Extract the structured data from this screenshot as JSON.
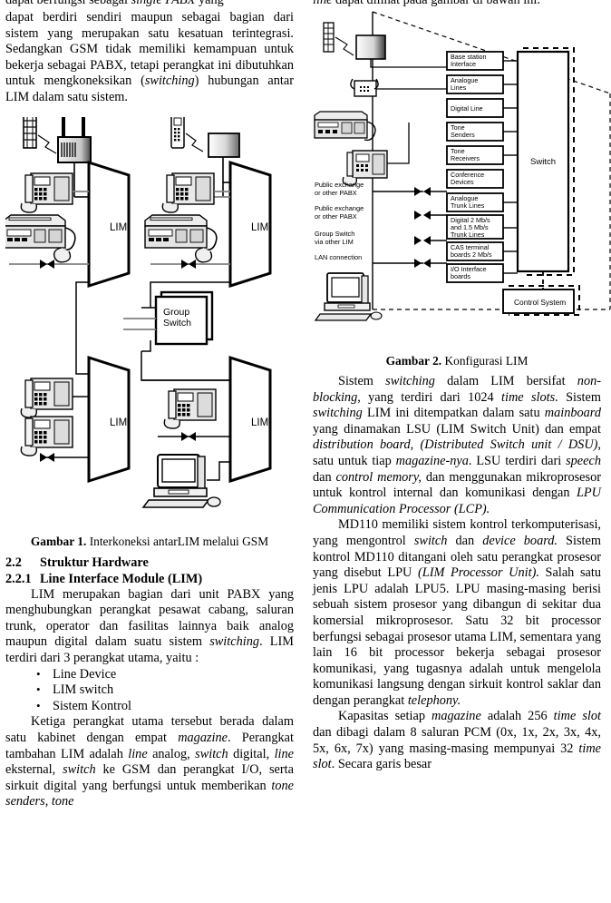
{
  "document": {
    "language": "id",
    "page_layout": "two-column"
  },
  "left_column": {
    "paragraph_top_clipped": "dapat berfungsi sebagai single PABX yang",
    "paragraph_1": "dapat berdiri sendiri maupun sebagai bagian dari sistem yang merupakan satu kesatuan terintegrasi. Sedangkan GSM tidak memiliki kemampuan untuk bekerja sebagai PABX, tetapi perangkat ini dibutuhkan untuk mengkoneksikan (switching) hubungan antar LIM dalam satu sistem.",
    "figure1": {
      "caption_label": "Gambar 1.",
      "caption_text": "Interkoneksi antarLIM melalui GSM",
      "lim_label": "LIM",
      "group_switch_label_line1": "Group",
      "group_switch_label_line2": "Switch",
      "lim_blocks": [
        "LIM",
        "LIM",
        "LIM",
        "LIM"
      ]
    },
    "section_2_2": {
      "number": "2.2",
      "title": "Struktur Hardware"
    },
    "section_2_2_1": {
      "number": "2.2.1",
      "title": "Line Interface Module (LIM)"
    },
    "paragraph_2": "LIM merupakan bagian dari unit PABX yang menghubungkan perangkat pesawat cabang, saluran trunk, operator dan fasilitas lainnya baik analog maupun digital dalam suatu sistem switching. LIM terdiri dari 3 perangkat utama, yaitu :",
    "bullets": [
      "Line Device",
      "LIM switch",
      "Sistem Kontrol"
    ],
    "paragraph_3": "Ketiga perangkat utama tersebut berada dalam satu kabinet dengan empat magazine. Perangkat tambahan LIM adalah line analog, switch digital, line eksternal, switch ke GSM dan perangkat I/O, serta sirkuit digital yang berfungsi untuk memberikan tone senders, tone"
  },
  "right_column": {
    "paragraph_top_clipped": "line dapat dilihat pada gambar di bawah ini.",
    "figure2": {
      "caption_label": "Gambar 2.",
      "caption_text": "Konfigurasi LIM",
      "switch_label": "Switch",
      "control_system_label": "Control System",
      "device_boxes": [
        {
          "line1": "Base station",
          "line2": "Interface"
        },
        {
          "line1": "Analogue",
          "line2": "Lines"
        },
        {
          "line1": "Digital Line",
          "line2": ""
        },
        {
          "line1": "Tone",
          "line2": "Senders"
        },
        {
          "line1": "Tone",
          "line2": "Receivers"
        },
        {
          "line1": "Conference",
          "line2": "Devices"
        },
        {
          "line1": "Analogue",
          "line2": "Trunk Lines"
        },
        {
          "line1": "Digital 2 Mb/s",
          "line2": "and 1.5 Mb/s",
          "line3": "Trunk Lines"
        },
        {
          "line1": "CAS terminal",
          "line2": "boards 2 Mb/s"
        },
        {
          "line1": "I/O Interface",
          "line2": "boards"
        }
      ],
      "left_labels": [
        {
          "line1": "Public exchange",
          "line2": "or other PABX"
        },
        {
          "line1": "Public exchange",
          "line2": "or other PABX"
        },
        {
          "line1": "Group Switch",
          "line2": "via other LIM"
        },
        {
          "line1": "LAN connection",
          "line2": ""
        }
      ]
    },
    "paragraph_1": "Sistem switching dalam LIM bersifat non-blocking, yang terdiri dari 1024 time slots. Sistem switching LIM ini ditempatkan dalam satu mainboard  yang dinamakan LSU (LIM Switch Unit) dan empat distribution board, (Distributed Switch unit / DSU), satu untuk tiap magazine-nya. LSU terdiri dari speech dan control memory, dan menggunakan mikroprosesor untuk kontrol internal dan komunikasi dengan LPU Communication Processor (LCP).",
    "paragraph_2": "MD110 memiliki sistem kontrol terkomputerisasi, yang mengontrol switch dan device board. Sistem kontrol MD110 ditangani oleh satu perangkat prosesor  yang disebut LPU (LIM Processor Unit). Salah satu jenis LPU adalah LPU5. LPU masing-masing berisi sebuah sistem prosesor yang dibangun di sekitar dua komersial mikroprosesor. Satu 32 bit processor berfungsi sebagai prosesor utama LIM, sementara yang lain 16 bit processor bekerja sebagai prosesor komunikasi, yang tugasnya adalah untuk mengelola komunikasi langsung dengan sirkuit kontrol saklar dan dengan perangkat telephony.",
    "paragraph_3": "Kapasitas setiap magazine adalah 256 time slot dan dibagi dalam 8 saluran PCM (0x, 1x, 2x, 3x, 4x, 5x, 6x, 7x) yang masing-masing mempunyai 32 time slot. Secara garis besar"
  },
  "colors": {
    "text": "#000000",
    "background": "#ffffff",
    "diagram_line": "#000000",
    "diagram_gray": "#808080",
    "device_fill": "#e8e8e8"
  }
}
